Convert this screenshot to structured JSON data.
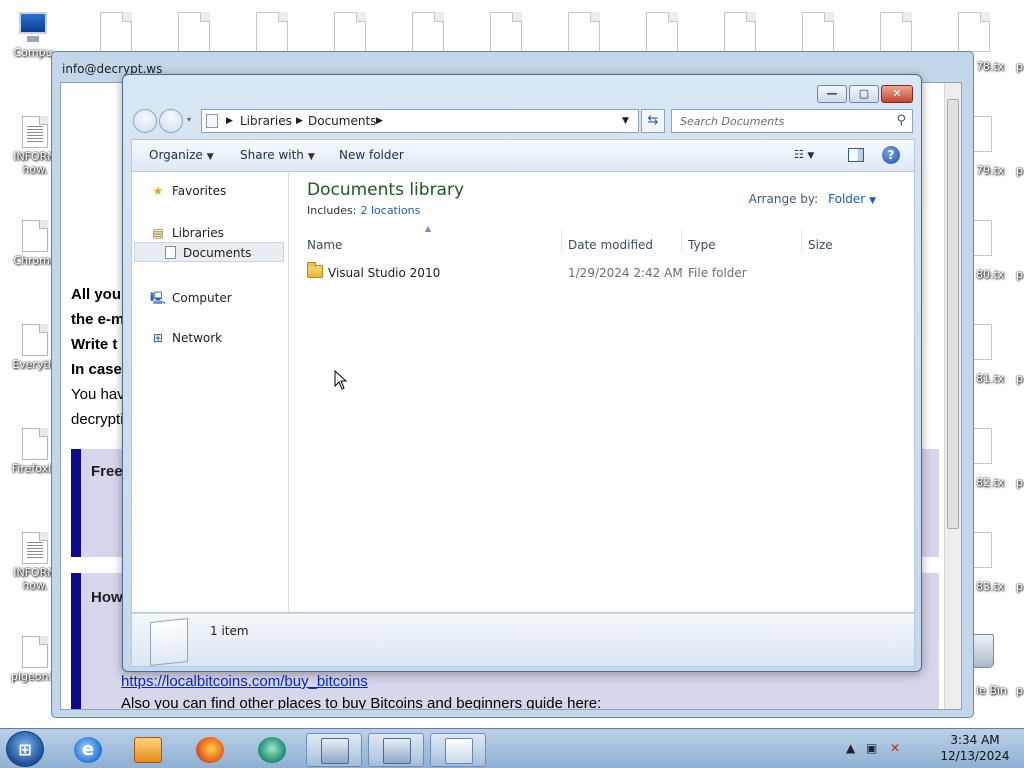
{
  "desktop": {
    "left_icons": [
      {
        "label": "Compu",
        "icon": "computer-icon"
      },
      {
        "label": "INFORM how.",
        "icon": "document-icon"
      },
      {
        "label": "Chrome",
        "icon": "file-icon"
      },
      {
        "label": "Everythi",
        "icon": "file-icon"
      },
      {
        "label": "FirefoxIn",
        "icon": "file-icon"
      },
      {
        "label": "INFORM how.",
        "icon": "document-icon"
      },
      {
        "label": "pigeon1.",
        "icon": "file-icon"
      }
    ],
    "right_labels": [
      "78.tx",
      "79.tx",
      "80.tx",
      "81.tx",
      "82.tx",
      "83.tx",
      "le Bin"
    ],
    "far_right_labels": [
      "p",
      "p",
      "p",
      "p",
      "p",
      "p",
      "p"
    ]
  },
  "note_window": {
    "title": "info@decrypt.ws",
    "lines": [
      "All you",
      "the e-m",
      "Write t",
      "In case",
      "You hav",
      "decrypti"
    ],
    "box1_heading": "Free",
    "box2_heading": "How",
    "link": "https://localbitcoins.com/buy_bitcoins",
    "also_text": "Also you can find other places to buy Bitcoins and beginners guide here:"
  },
  "explorer": {
    "caption_buttons": {
      "minimize": "—",
      "maximize": "▢",
      "close": "✕"
    },
    "address": {
      "segments": [
        "Libraries",
        "Documents"
      ]
    },
    "search": {
      "placeholder": "Search Documents"
    },
    "toolbar": {
      "organize": "Organize",
      "share_with": "Share with",
      "new_folder": "New folder"
    },
    "nav": {
      "favorites": "Favorites",
      "libraries": "Libraries",
      "documents": "Documents",
      "computer": "Computer",
      "network": "Network"
    },
    "library": {
      "title": "Documents library",
      "includes_label": "Includes:",
      "includes_link": "2 locations",
      "arrange_label": "Arrange by:",
      "arrange_value": "Folder"
    },
    "columns": [
      "Name",
      "Date modified",
      "Type",
      "Size"
    ],
    "rows": [
      {
        "name": "Visual Studio 2010",
        "date": "1/29/2024 2:42 AM",
        "type": "File folder",
        "size": ""
      }
    ],
    "details": {
      "count": "1 item"
    }
  },
  "taskbar": {
    "time": "3:34 AM",
    "date": "12/13/2024"
  },
  "colors": {
    "library_title": "#1e5a1e",
    "link": "#1b5fb8",
    "note_box_border": "#0a0a8a"
  }
}
